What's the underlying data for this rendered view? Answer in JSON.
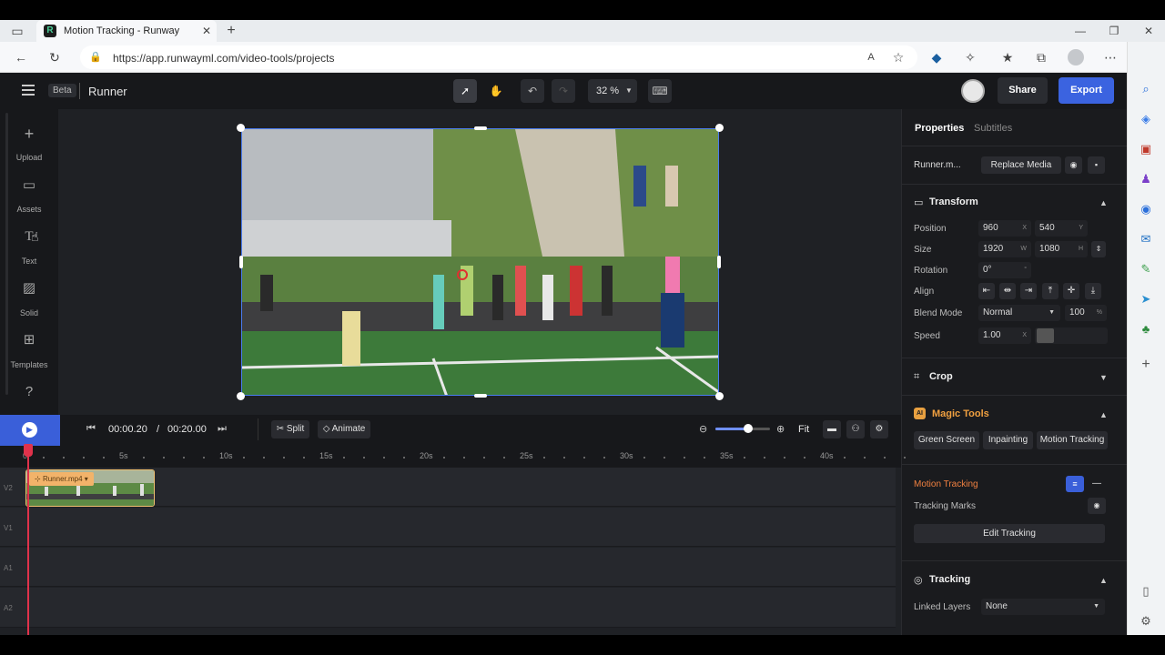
{
  "browser": {
    "tab_title": "Motion Tracking - Runway",
    "url": "https://app.runwayml.com/video-tools/projects"
  },
  "header": {
    "badge": "Beta",
    "project_name": "Runner",
    "zoom": "32 %",
    "share_label": "Share",
    "export_label": "Export"
  },
  "left_bar": {
    "items": [
      {
        "label": "Upload"
      },
      {
        "label": "Assets"
      },
      {
        "label": "Text"
      },
      {
        "label": "Solid"
      },
      {
        "label": "Templates"
      }
    ]
  },
  "timeline": {
    "current_time": "00:00.20",
    "separator": "/",
    "duration": "00:20.00",
    "split_label": "Split",
    "animate_label": "Animate",
    "fit_label": "Fit",
    "zoom_level": 0.6,
    "ticks": [
      "0",
      "5s",
      "10s",
      "15s",
      "20s",
      "25s",
      "30s",
      "35s",
      "40s"
    ],
    "tracks": [
      "V2",
      "V1",
      "A1",
      "A2"
    ],
    "clip_name": "Runner.mp4"
  },
  "properties": {
    "tab_properties": "Properties",
    "tab_subtitles": "Subtitles",
    "media_name": "Runner.m...",
    "replace_media": "Replace Media",
    "transform": {
      "title": "Transform",
      "position_label": "Position",
      "position_x": "960",
      "position_y": "540",
      "size_label": "Size",
      "size_w": "1920",
      "size_h": "1080",
      "rotation_label": "Rotation",
      "rotation": "0°",
      "align_label": "Align",
      "blend_label": "Blend Mode",
      "blend_value": "Normal",
      "opacity": "100",
      "opacity_unit": "%",
      "speed_label": "Speed",
      "speed_value": "1.00",
      "unit_x": "X",
      "unit_y": "Y",
      "unit_w": "W",
      "unit_h": "H",
      "unit_deg": "°",
      "unit_speed": "X"
    },
    "crop_title": "Crop",
    "magic": {
      "badge": "AI",
      "title": "Magic Tools",
      "green_screen": "Green Screen",
      "inpainting": "Inpainting",
      "motion_tracking": "Motion Tracking"
    },
    "motion_tracking_label": "Motion Tracking",
    "tracking_marks_label": "Tracking Marks",
    "edit_tracking": "Edit Tracking",
    "tracking_title": "Tracking",
    "linked_layers_label": "Linked Layers",
    "linked_layers_value": "None"
  },
  "colors": {
    "accent": "#3a5fd9",
    "export": "#3b63e0",
    "playhead": "#e0324b",
    "magic_label": "#f0a040",
    "motion_label": "#f08040"
  }
}
